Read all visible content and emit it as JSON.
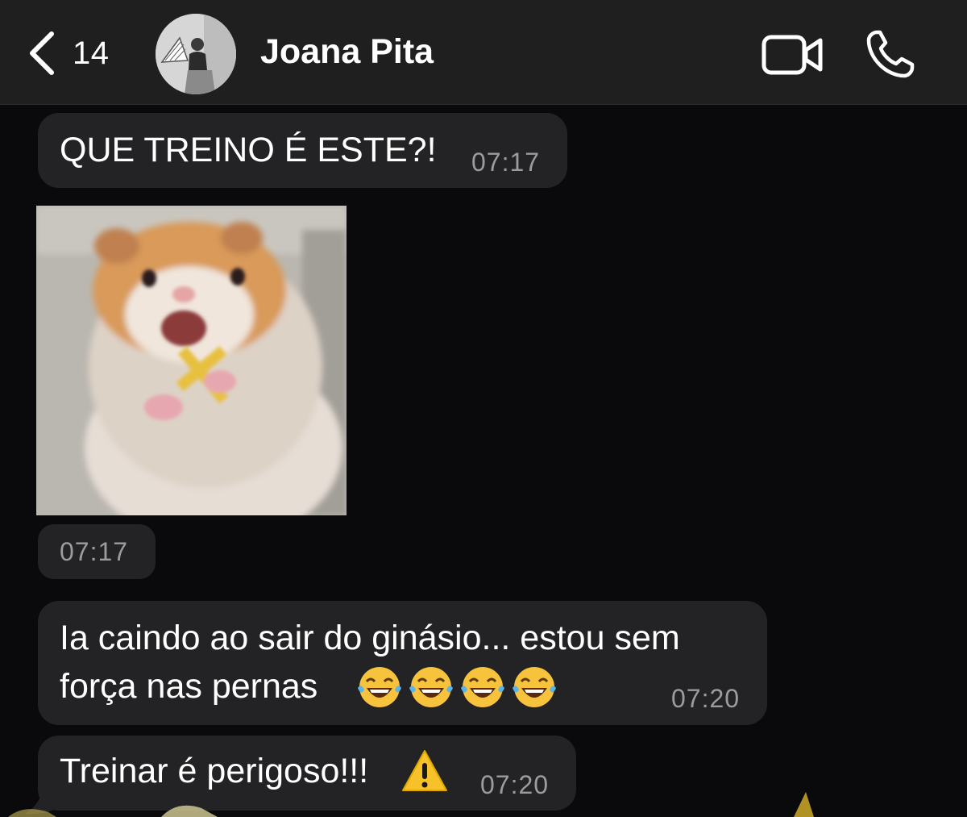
{
  "header": {
    "back_icon": "chevron-left-icon",
    "unread_count": "14",
    "contact_name": "Joana Pita",
    "video_icon": "video-camera-icon",
    "call_icon": "phone-icon"
  },
  "messages": [
    {
      "text": "QUE TREINO É ESTE?!",
      "time": "07:17"
    },
    {
      "type": "sticker",
      "sticker": "scared-hamster-with-cross",
      "time": "07:17"
    },
    {
      "line1": "Ia caindo ao sair do ginásio... estou sem",
      "line2": "força nas pernas",
      "emoji": "tears-of-joy-emoji",
      "emoji_count": 4,
      "time": "07:20"
    },
    {
      "text": "Treinar é perigoso!!!",
      "emoji": "warning-emoji",
      "time": "07:20"
    }
  ],
  "colors": {
    "background": "#0a0a0c",
    "header": "#1f1f1f",
    "bubble": "#232325",
    "timestamp": "#9c9c9f"
  }
}
